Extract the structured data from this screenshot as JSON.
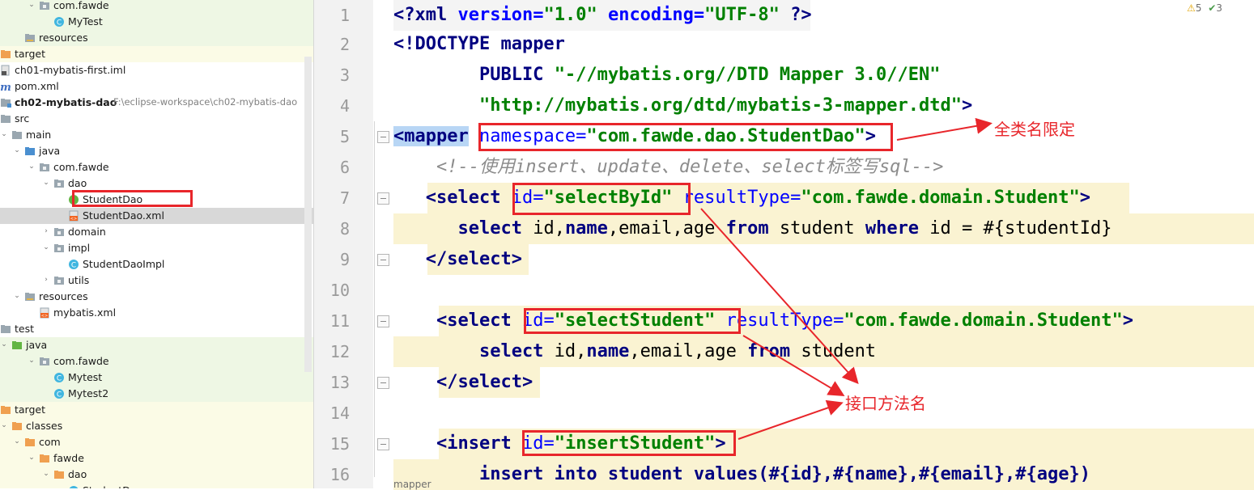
{
  "tree": [
    {
      "label": "com.fawde",
      "type": "package",
      "arrow": "open",
      "bg": "green"
    },
    {
      "label": "MyTest",
      "type": "class",
      "bg": "green"
    },
    {
      "label": "resources",
      "type": "res",
      "bg": "green"
    },
    {
      "label": "target",
      "type": "orange-folder",
      "bg": "yellow"
    },
    {
      "label": "ch01-mybatis-first.iml",
      "type": "iml"
    },
    {
      "label": "pom.xml",
      "type": "maven"
    },
    {
      "label": "ch02-mybatis-dao",
      "path": "F:\\eclipse-workspace\\ch02-mybatis-dao",
      "type": "module",
      "bold": true
    },
    {
      "label": "src",
      "type": "folder",
      "arrow": "open"
    },
    {
      "label": "main",
      "type": "folder",
      "arrow": "open"
    },
    {
      "label": "java",
      "type": "blue-folder",
      "arrow": "open"
    },
    {
      "label": "com.fawde",
      "type": "package",
      "arrow": "open"
    },
    {
      "label": "dao",
      "type": "package",
      "arrow": "open"
    },
    {
      "label": "StudentDao",
      "type": "interface"
    },
    {
      "label": "StudentDao.xml",
      "type": "xml",
      "bg": "sel"
    },
    {
      "label": "domain",
      "type": "package",
      "arrow": "closed"
    },
    {
      "label": "impl",
      "type": "package",
      "arrow": "open"
    },
    {
      "label": "StudentDaoImpl",
      "type": "class"
    },
    {
      "label": "utils",
      "type": "package",
      "arrow": "closed"
    },
    {
      "label": "resources",
      "type": "res",
      "arrow": "open"
    },
    {
      "label": "mybatis.xml",
      "type": "xml"
    },
    {
      "label": "test",
      "type": "folder",
      "arrow": "open"
    },
    {
      "label": "java",
      "type": "green-folder",
      "arrow": "open",
      "bg": "green"
    },
    {
      "label": "com.fawde",
      "type": "package",
      "arrow": "open",
      "bg": "green"
    },
    {
      "label": "Mytest",
      "type": "class",
      "bg": "green"
    },
    {
      "label": "Mytest2",
      "type": "class",
      "bg": "green"
    },
    {
      "label": "target",
      "type": "orange-folder",
      "arrow": "open",
      "bg": "yellow"
    },
    {
      "label": "classes",
      "type": "orange-folder",
      "arrow": "open",
      "bg": "yellow"
    },
    {
      "label": "com",
      "type": "orange-folder",
      "arrow": "open",
      "bg": "yellow"
    },
    {
      "label": "fawde",
      "type": "orange-folder",
      "arrow": "open",
      "bg": "yellow"
    },
    {
      "label": "dao",
      "type": "orange-folder",
      "arrow": "open",
      "bg": "yellow"
    },
    {
      "label": "StudentD...",
      "type": "class",
      "bg": "yellow"
    }
  ],
  "editor": {
    "line_numbers": [
      "1",
      "2",
      "3",
      "4",
      "5",
      "6",
      "7",
      "8",
      "9",
      "10",
      "11",
      "12",
      "13",
      "14",
      "15",
      "16"
    ],
    "l1": {
      "a": "<?",
      "b": "xml",
      "c": " version=",
      "d": "\"1.0\"",
      "e": " encoding=",
      "f": "\"UTF-8\"",
      "g": " ?>"
    },
    "l2": {
      "a": "<!DOCTYPE ",
      "b": "mapper"
    },
    "l3": {
      "a": "        PUBLIC ",
      "b": "\"-//mybatis.org//DTD Mapper 3.0//EN\""
    },
    "l4": {
      "a": "        ",
      "b": "\"http://mybatis.org/dtd/mybatis-3-mapper.dtd\"",
      "c": ">"
    },
    "l5": {
      "a": "<mapper",
      "b": " ",
      "c": "namespace=",
      "d": "\"com.fawde.dao.StudentDao\"",
      "e": ">"
    },
    "l6": {
      "a": "    <!--使用insert、update、delete、select标签写sql-->"
    },
    "l7": {
      "a": "   <",
      "b": "select",
      "c": " id=",
      "d": "\"selectById\"",
      "e": " resultType=",
      "f": "\"com.fawde.domain.Student\"",
      "g": ">"
    },
    "l8": {
      "a": "      select",
      "b": " id,",
      "c": "name",
      "d": ",email,age ",
      "e": "from",
      "f": " student ",
      "g": "where",
      "h": " id = #{studentId}"
    },
    "l9": {
      "a": "   </",
      "b": "select",
      "c": ">"
    },
    "l11": {
      "a": "    <",
      "b": "select",
      "c": " id=",
      "d": "\"selectStudent\"",
      "e": " resultType=",
      "f": "\"com.fawde.domain.Student\"",
      "g": ">"
    },
    "l12": {
      "a": "        select",
      "b": " id,",
      "c": "name",
      "d": ",email,age ",
      "e": "from",
      "f": " student"
    },
    "l13": {
      "a": "    </",
      "b": "select",
      "c": ">"
    },
    "l15": {
      "a": "    <",
      "b": "insert",
      "c": " id=",
      "d": "\"insertStudent\"",
      "e": ">"
    },
    "l16": {
      "a": "        insert into student values(#{id},#{name},#{email},#{age})"
    }
  },
  "annotations": {
    "namespace_note": "全类名限定",
    "method_note": "接口方法名"
  },
  "inspections": {
    "warnings": "5",
    "checks": "3"
  },
  "breadcrumb": "mapper"
}
